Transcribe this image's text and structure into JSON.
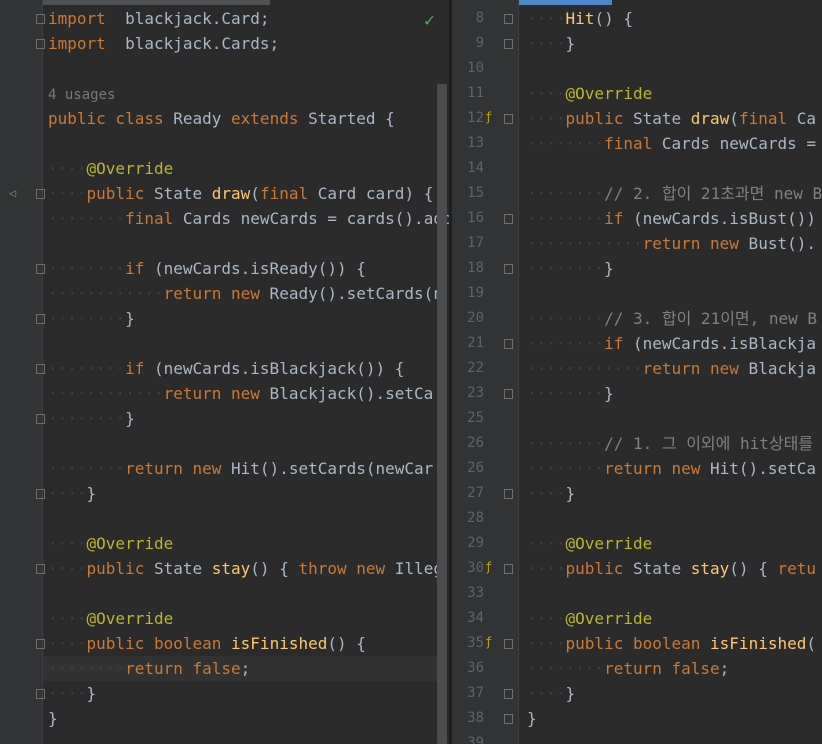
{
  "left": {
    "lines": [
      {
        "ws": "",
        "parts": [
          [
            "kw",
            "import"
          ],
          [
            "",
            "  blackjack.Card;"
          ]
        ]
      },
      {
        "ws": "",
        "parts": [
          [
            "kw",
            "import"
          ],
          [
            "",
            "  blackjack.Cards;"
          ]
        ]
      },
      {
        "ws": "",
        "parts": []
      },
      {
        "ws": "",
        "parts": [
          [
            "hint",
            "4 usages"
          ]
        ]
      },
      {
        "ws": "",
        "parts": [
          [
            "kw",
            "public class"
          ],
          [
            "",
            " Ready "
          ],
          [
            "kw",
            "extends"
          ],
          [
            "",
            " Started {"
          ]
        ]
      },
      {
        "ws": "",
        "parts": []
      },
      {
        "ws": "····",
        "parts": [
          [
            "an",
            "@Override"
          ]
        ]
      },
      {
        "ws": "····",
        "parts": [
          [
            "kw",
            "public"
          ],
          [
            "",
            " State "
          ],
          [
            "fn",
            "draw"
          ],
          [
            "",
            "("
          ],
          [
            "kw",
            "final"
          ],
          [
            "",
            " Card card) {"
          ]
        ]
      },
      {
        "ws": "········",
        "parts": [
          [
            "kw",
            "final"
          ],
          [
            "",
            " Cards newCards = cards().add"
          ]
        ]
      },
      {
        "ws": "",
        "parts": []
      },
      {
        "ws": "········",
        "parts": [
          [
            "kw",
            "if"
          ],
          [
            "",
            " (newCards.isReady()) {"
          ]
        ]
      },
      {
        "ws": "············",
        "parts": [
          [
            "kw",
            "return new"
          ],
          [
            "",
            " Ready().setCards(n"
          ]
        ]
      },
      {
        "ws": "········",
        "parts": [
          [
            "",
            "}"
          ]
        ]
      },
      {
        "ws": "",
        "parts": []
      },
      {
        "ws": "········",
        "parts": [
          [
            "kw",
            "if"
          ],
          [
            "",
            " (newCards.isBlackjack()) {"
          ]
        ]
      },
      {
        "ws": "············",
        "parts": [
          [
            "kw",
            "return new"
          ],
          [
            "",
            " Blackjack().setCa"
          ]
        ]
      },
      {
        "ws": "········",
        "parts": [
          [
            "",
            "}"
          ]
        ]
      },
      {
        "ws": "",
        "parts": []
      },
      {
        "ws": "········",
        "parts": [
          [
            "kw",
            "return new"
          ],
          [
            "",
            " Hit().setCards(newCar"
          ]
        ]
      },
      {
        "ws": "····",
        "parts": [
          [
            "",
            "}"
          ]
        ]
      },
      {
        "ws": "",
        "parts": []
      },
      {
        "ws": "····",
        "parts": [
          [
            "an",
            "@Override"
          ]
        ]
      },
      {
        "ws": "····",
        "parts": [
          [
            "kw",
            "public"
          ],
          [
            "",
            " State "
          ],
          [
            "fn",
            "stay"
          ],
          [
            "",
            "() { "
          ],
          [
            "kw",
            "throw new"
          ],
          [
            "",
            " Illeg"
          ]
        ]
      },
      {
        "ws": "",
        "parts": []
      },
      {
        "ws": "····",
        "parts": [
          [
            "an",
            "@Override"
          ]
        ]
      },
      {
        "ws": "····",
        "parts": [
          [
            "kw",
            "public boolean"
          ],
          [
            "",
            " "
          ],
          [
            "fn",
            "isFinished"
          ],
          [
            "",
            "() {"
          ]
        ]
      },
      {
        "ws": "········",
        "parts": [
          [
            "kw",
            "return false"
          ],
          [
            "",
            ";"
          ]
        ]
      },
      {
        "ws": "····",
        "parts": [
          [
            "",
            "}"
          ]
        ]
      },
      {
        "ws": "",
        "parts": [
          [
            "",
            "}"
          ]
        ]
      }
    ]
  },
  "right": {
    "lines": [
      {
        "n": "8",
        "ws": "····",
        "parts": [
          [
            "fn",
            "Hit"
          ],
          [
            "",
            "() {"
          ]
        ]
      },
      {
        "n": "9",
        "ws": "····",
        "parts": [
          [
            "",
            "}"
          ]
        ]
      },
      {
        "n": "10",
        "ws": "",
        "parts": []
      },
      {
        "n": "11",
        "ws": "····",
        "parts": [
          [
            "an",
            "@Override"
          ]
        ]
      },
      {
        "n": "12",
        "ws": "····",
        "parts": [
          [
            "kw",
            "public"
          ],
          [
            "",
            " State "
          ],
          [
            "fn",
            "draw"
          ],
          [
            "",
            "("
          ],
          [
            "kw",
            "final"
          ],
          [
            "",
            " Ca"
          ]
        ]
      },
      {
        "n": "13",
        "ws": "········",
        "parts": [
          [
            "kw",
            "final"
          ],
          [
            "",
            " Cards newCards = "
          ]
        ]
      },
      {
        "n": "14",
        "ws": "",
        "parts": []
      },
      {
        "n": "15",
        "ws": "········",
        "parts": [
          [
            "cm",
            "// 2. 합이 21초과면 new B"
          ]
        ]
      },
      {
        "n": "16",
        "ws": "········",
        "parts": [
          [
            "kw",
            "if"
          ],
          [
            "",
            " (newCards.isBust())"
          ]
        ]
      },
      {
        "n": "17",
        "ws": "············",
        "parts": [
          [
            "kw",
            "return new"
          ],
          [
            "",
            " Bust()."
          ]
        ]
      },
      {
        "n": "18",
        "ws": "········",
        "parts": [
          [
            "",
            "}"
          ]
        ]
      },
      {
        "n": "19",
        "ws": "",
        "parts": []
      },
      {
        "n": "20",
        "ws": "········",
        "parts": [
          [
            "cm",
            "// 3. 합이 21이면, new B"
          ]
        ]
      },
      {
        "n": "21",
        "ws": "········",
        "parts": [
          [
            "kw",
            "if"
          ],
          [
            "",
            " (newCards.isBlackja"
          ]
        ]
      },
      {
        "n": "22",
        "ws": "············",
        "parts": [
          [
            "kw",
            "return new"
          ],
          [
            "",
            " Blackja"
          ]
        ]
      },
      {
        "n": "23",
        "ws": "········",
        "parts": [
          [
            "",
            "}"
          ]
        ]
      },
      {
        "n": "25",
        "ws": "",
        "parts": []
      },
      {
        "n": "26",
        "ws": "········",
        "parts": [
          [
            "cm",
            "// 1. 그 이외에 hit상태를"
          ]
        ]
      },
      {
        "n": "26",
        "ws": "········",
        "parts": [
          [
            "kw",
            "return new"
          ],
          [
            "",
            " Hit().setCa"
          ]
        ]
      },
      {
        "n": "27",
        "ws": "····",
        "parts": [
          [
            "",
            "}"
          ]
        ]
      },
      {
        "n": "28",
        "ws": "",
        "parts": []
      },
      {
        "n": "29",
        "ws": "····",
        "parts": [
          [
            "an",
            "@Override"
          ]
        ]
      },
      {
        "n": "30",
        "ws": "····",
        "parts": [
          [
            "kw",
            "public"
          ],
          [
            "",
            " State "
          ],
          [
            "fn",
            "stay"
          ],
          [
            "",
            "() { "
          ],
          [
            "kw",
            "retu"
          ]
        ]
      },
      {
        "n": "33",
        "ws": "",
        "parts": []
      },
      {
        "n": "34",
        "ws": "····",
        "parts": [
          [
            "an",
            "@Override"
          ]
        ]
      },
      {
        "n": "35",
        "ws": "····",
        "parts": [
          [
            "kw",
            "public boolean"
          ],
          [
            "",
            " "
          ],
          [
            "fn",
            "isFinished"
          ],
          [
            "",
            "("
          ]
        ]
      },
      {
        "n": "36",
        "ws": "········",
        "parts": [
          [
            "kw",
            "return false"
          ],
          [
            "",
            ";"
          ]
        ]
      },
      {
        "n": "37",
        "ws": "····",
        "parts": [
          [
            "",
            "}"
          ]
        ]
      },
      {
        "n": "38",
        "ws": "",
        "parts": [
          [
            "",
            "}"
          ]
        ]
      },
      {
        "n": "39",
        "ws": "",
        "parts": []
      }
    ]
  }
}
